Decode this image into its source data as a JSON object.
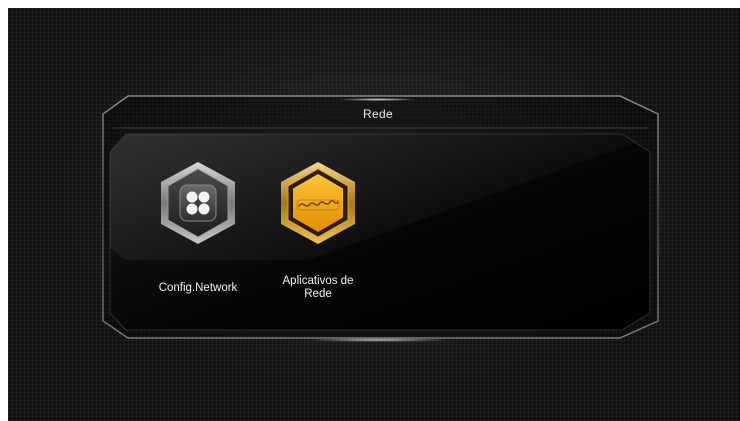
{
  "panel": {
    "title": "Rede"
  },
  "apps": [
    {
      "label_line1": "Config.Network",
      "label_line2": "",
      "icon": "network-config-icon",
      "color": "#9a9a9a",
      "selected": false
    },
    {
      "label_line1": "Aplicativos de",
      "label_line2": "Rede",
      "icon": "network-apps-icon",
      "color": "#f0a81c",
      "selected": true
    }
  ],
  "colors": {
    "background": "#111111",
    "accent": "#f0a81c",
    "text": "#f2f2f2"
  }
}
